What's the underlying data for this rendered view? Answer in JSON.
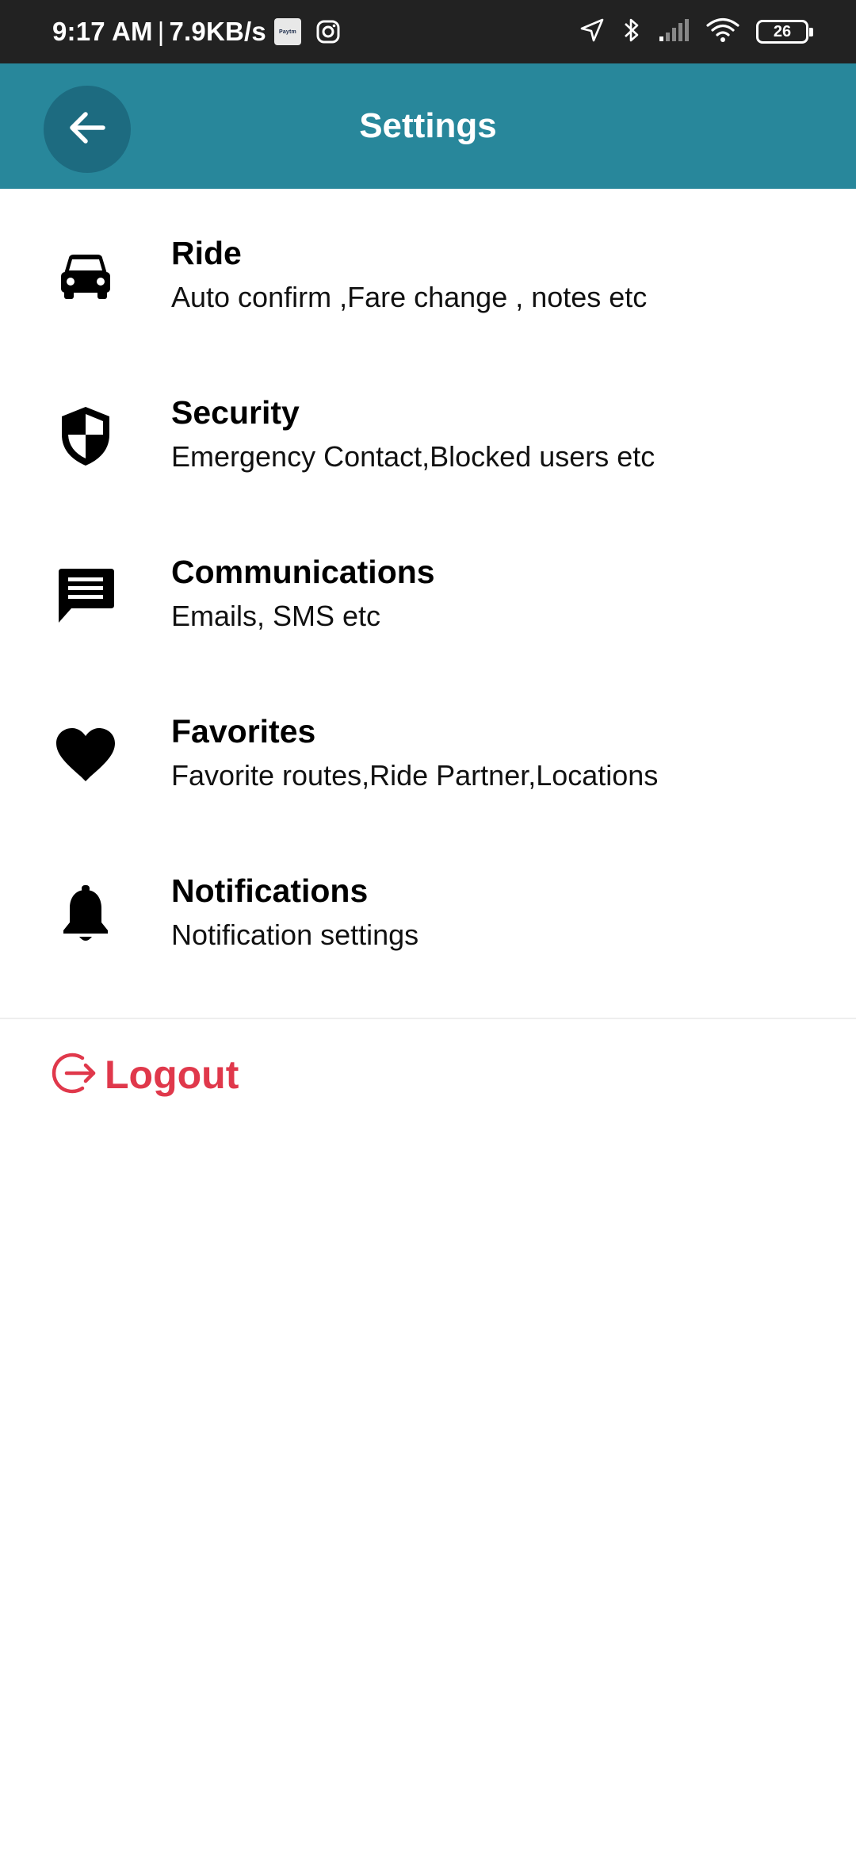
{
  "status_bar": {
    "time": "9:17 AM",
    "separator": "|",
    "speed": "7.9KB/s",
    "paytm_label": "Paytm",
    "battery": "26"
  },
  "header": {
    "title": "Settings",
    "back_icon": "arrow-left-icon",
    "bar_color": "#28879b"
  },
  "settings": {
    "items": [
      {
        "icon": "car-icon",
        "title": "Ride",
        "subtitle": "Auto confirm ,Fare change , notes etc"
      },
      {
        "icon": "shield-icon",
        "title": "Security",
        "subtitle": "Emergency Contact,Blocked users etc"
      },
      {
        "icon": "message-icon",
        "title": "Communications",
        "subtitle": "Emails, SMS etc"
      },
      {
        "icon": "heart-icon",
        "title": "Favorites",
        "subtitle": "Favorite routes,Ride Partner,Locations"
      },
      {
        "icon": "bell-icon",
        "title": "Notifications",
        "subtitle": "Notification settings"
      }
    ]
  },
  "logout": {
    "label": "Logout",
    "icon": "logout-icon",
    "color": "#e0384b"
  }
}
